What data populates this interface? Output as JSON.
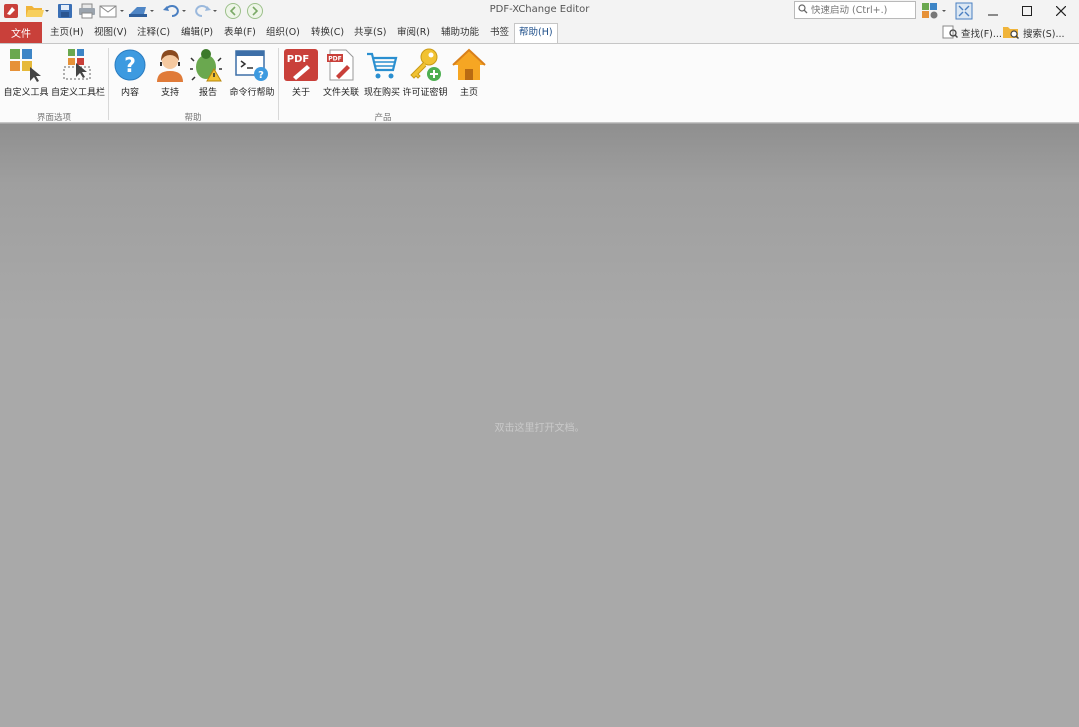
{
  "app": {
    "title": "PDF-XChange Editor"
  },
  "quick_search": {
    "placeholder": "快速启动 (Ctrl+.)"
  },
  "menu": {
    "file": "文件",
    "tabs": [
      "主页(H)",
      "视图(V)",
      "注释(C)",
      "编辑(P)",
      "表单(F)",
      "组织(O)",
      "转换(C)",
      "共享(S)",
      "审阅(R)",
      "辅助功能",
      "书签",
      "帮助(H)"
    ],
    "active_tab": "帮助(H)",
    "find": "查找(F)...",
    "search": "搜索(S)..."
  },
  "ribbon": {
    "groups": [
      {
        "label": "界面选项",
        "buttons": [
          "自定义工具",
          "自定义工具栏"
        ]
      },
      {
        "label": "帮助",
        "buttons": [
          "内容",
          "支持",
          "报告",
          "命令行帮助"
        ]
      },
      {
        "label": "产品",
        "buttons": [
          "关于",
          "文件关联",
          "现在购买",
          "许可证密钥",
          "主页"
        ]
      }
    ]
  },
  "workspace": {
    "hint": "双击这里打开文档。"
  },
  "colors": {
    "accent": "#c9403a",
    "active_tab_text": "#1e4f8a",
    "workspace_bg": "#a9a9a9"
  },
  "icons": [
    "app-icon",
    "open-folder-icon",
    "save-icon",
    "print-icon",
    "email-icon",
    "scan-icon",
    "undo-icon",
    "redo-icon",
    "back-icon",
    "forward-icon",
    "search-icon",
    "customize-tools-icon",
    "customize-toolbars-icon",
    "help-icon",
    "support-icon",
    "bug-report-icon",
    "command-line-help-icon",
    "pdf-about-icon",
    "file-association-icon",
    "cart-icon",
    "license-key-icon",
    "home-icon"
  ]
}
